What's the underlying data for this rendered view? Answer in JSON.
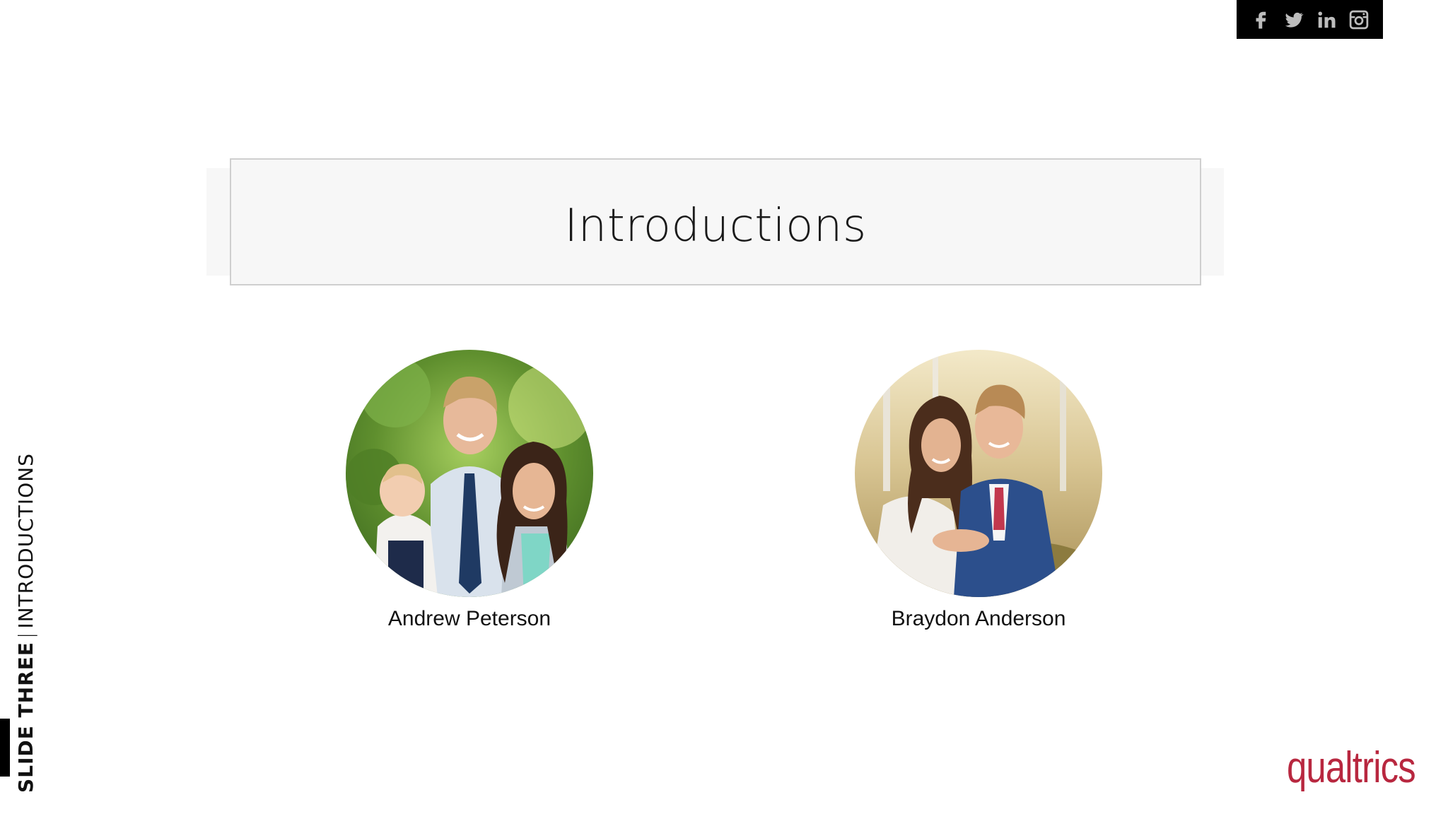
{
  "social": {
    "icons": [
      "facebook-icon",
      "twitter-icon",
      "linkedin-icon",
      "instagram-icon"
    ],
    "background": "#000000",
    "icon_color": "#bdbdbd"
  },
  "title": "Introductions",
  "people": [
    {
      "name": "Andrew Peterson"
    },
    {
      "name": "Braydon Anderson"
    }
  ],
  "side_label": {
    "primary": "SLIDE THREE",
    "separator": "|",
    "secondary": "INTRODUCTIONS"
  },
  "logo": "qualtrics",
  "colors": {
    "logo": "#b8273f",
    "title_bg": "#f7f7f7"
  }
}
